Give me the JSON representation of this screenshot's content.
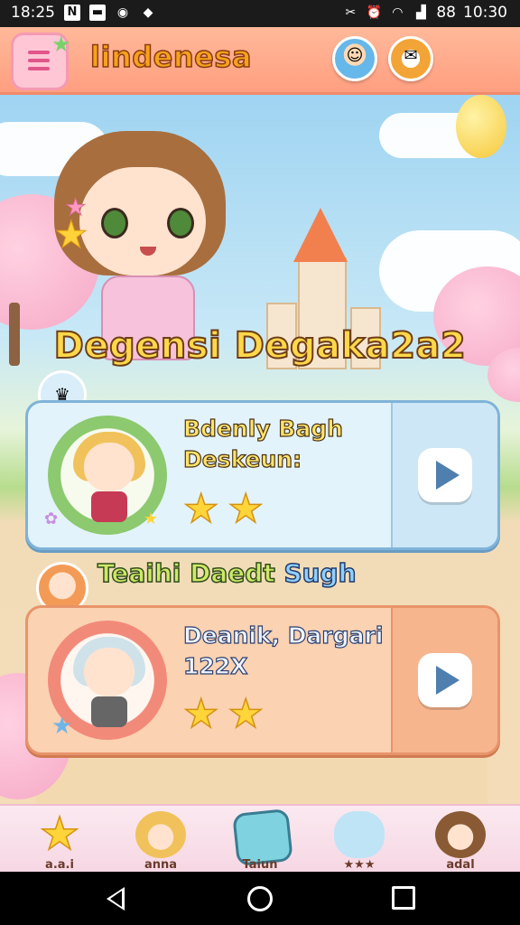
{
  "status_bar": {
    "time_left": "18:25",
    "time_right": "10:30",
    "signal_text": "88",
    "icons": [
      "n-icon",
      "screen-icon",
      "circle-app-icon",
      "paper-plane-icon",
      "scissors-icon",
      "alarm-icon",
      "wifi-icon",
      "signal-icon"
    ]
  },
  "header": {
    "app_title": "lindenesa",
    "menu_icon": "menu-icon",
    "avatar_buttons": [
      "profile-avatar-icon",
      "gift-avatar-icon"
    ]
  },
  "scene": {
    "banner_title": "Degensi Degaka2a2"
  },
  "cards": [
    {
      "title_line1": "Bdenly Bagh",
      "title_line2": "Deskeun:",
      "stars": "★★",
      "play_icon": "play-icon"
    },
    {
      "title_line1": "Deanik, Dargari",
      "title_line2": "122X",
      "stars": "★★",
      "play_icon": "play-icon"
    }
  ],
  "section": {
    "heading_main": "Teaihi Daedt",
    "heading_accent": "Sugh"
  },
  "tabbar": {
    "tabs": [
      {
        "label": "a.a.i",
        "icon": "star-icon"
      },
      {
        "label": "anna",
        "icon": "girl-avatar-icon"
      },
      {
        "label": "Taiun",
        "icon": "pink-creature-icon"
      },
      {
        "label": "★★★",
        "icon": "blue-creature-icon"
      },
      {
        "label": "adal",
        "icon": "boy-avatar-icon"
      }
    ]
  },
  "nav": {
    "buttons": [
      "back-icon",
      "home-icon",
      "recent-apps-icon"
    ]
  },
  "colors": {
    "header_bg": "#ff9f80",
    "title_fill": "#f6a21c",
    "card1_bg": "#e3f3fb",
    "card2_bg": "#fbd2b2",
    "star": "#ffd53a"
  }
}
